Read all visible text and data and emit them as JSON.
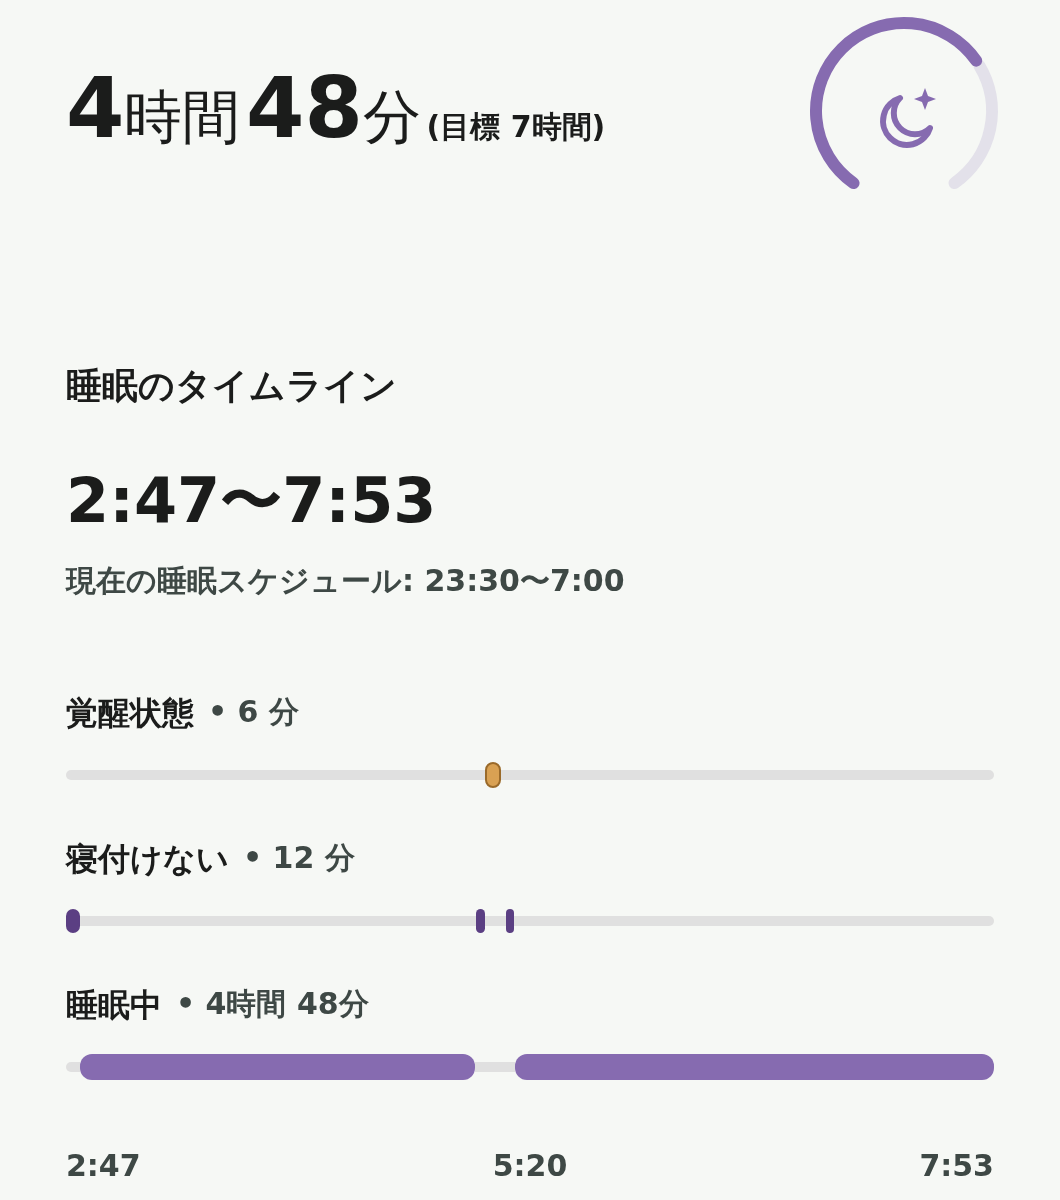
{
  "summary": {
    "hours": "4",
    "hours_unit": "時間",
    "minutes": "48",
    "minutes_unit": "分",
    "goal": "(目標 7時間)"
  },
  "timeline": {
    "title": "睡眠のタイムライン",
    "range": "2:47〜7:53",
    "schedule": "現在の睡眠スケジュール: 23:30〜7:00",
    "stages": [
      {
        "kind": "awake",
        "name": "覚醒状態",
        "detail": "• 6 分"
      },
      {
        "kind": "restless",
        "name": "寝付けない",
        "detail": "• 12 分"
      },
      {
        "kind": "asleep",
        "name": "睡眠中",
        "detail": "• 4時間 48分"
      }
    ],
    "axis_labels": [
      "2:47",
      "5:20",
      "7:53"
    ]
  }
}
